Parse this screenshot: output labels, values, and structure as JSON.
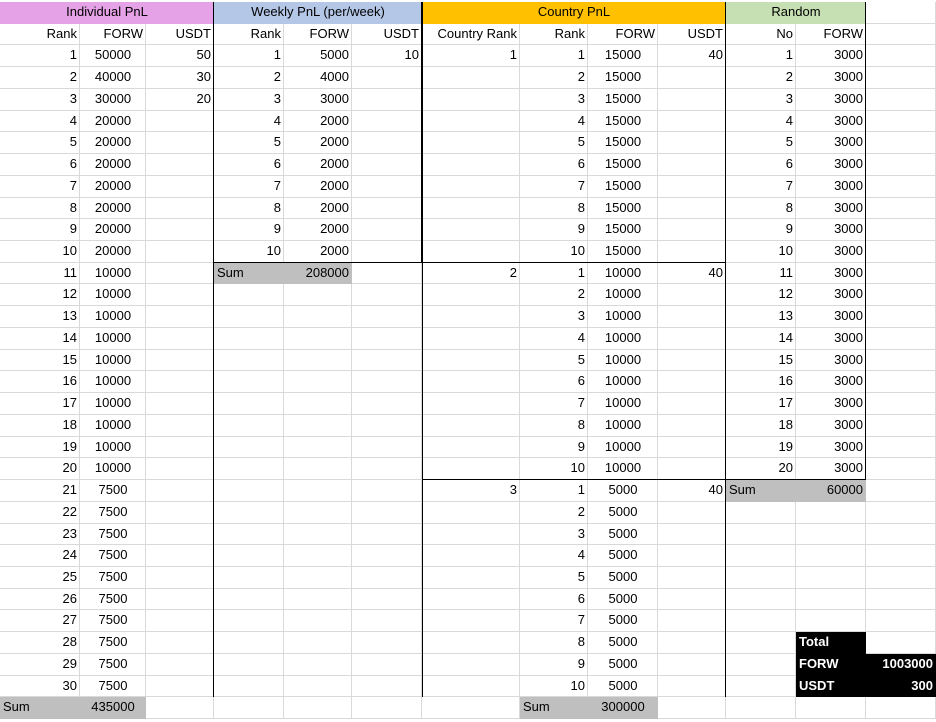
{
  "colors": {
    "individual_header": "#e6a2e6",
    "weekly_header": "#b4c7e7",
    "country_header": "#ffc000",
    "random_header": "#c6e0b4",
    "sum_fill": "#bfbfbf",
    "total_fill": "#000000"
  },
  "sections": {
    "individual": "Individual PnL",
    "weekly": "Weekly PnL (per/week)",
    "country": "Country PnL",
    "random": "Random"
  },
  "headers": {
    "individual": [
      "Rank",
      "FORW",
      "USDT"
    ],
    "weekly": [
      "Rank",
      "FORW",
      "USDT"
    ],
    "country": [
      "Country Rank",
      "Rank",
      "FORW",
      "USDT"
    ],
    "random": [
      "No",
      "FORW"
    ]
  },
  "individual": {
    "ranks": [
      "1",
      "2",
      "3",
      "4",
      "5",
      "6",
      "7",
      "8",
      "9",
      "10",
      "11",
      "12",
      "13",
      "14",
      "15",
      "16",
      "17",
      "18",
      "19",
      "20",
      "21",
      "22",
      "23",
      "24",
      "25",
      "26",
      "27",
      "28",
      "29",
      "30"
    ],
    "forw": [
      "50000",
      "40000",
      "30000",
      "20000",
      "20000",
      "20000",
      "20000",
      "20000",
      "20000",
      "20000",
      "10000",
      "10000",
      "10000",
      "10000",
      "10000",
      "10000",
      "10000",
      "10000",
      "10000",
      "10000",
      "7500",
      "7500",
      "7500",
      "7500",
      "7500",
      "7500",
      "7500",
      "7500",
      "7500",
      "7500"
    ],
    "usdt": [
      "50",
      "30",
      "20"
    ],
    "sum_label": "Sum",
    "sum_value": "435000"
  },
  "weekly": {
    "ranks": [
      "1",
      "2",
      "3",
      "4",
      "5",
      "6",
      "7",
      "8",
      "9",
      "10"
    ],
    "forw": [
      "5000",
      "4000",
      "3000",
      "2000",
      "2000",
      "2000",
      "2000",
      "2000",
      "2000",
      "2000"
    ],
    "usdt": [
      "10"
    ],
    "sum_label": "Sum",
    "sum_value": "208000"
  },
  "country": {
    "groups": [
      {
        "country_rank": "1",
        "usdt": "40",
        "ranks": [
          "1",
          "2",
          "3",
          "4",
          "5",
          "6",
          "7",
          "8",
          "9",
          "10"
        ],
        "forw": [
          "15000",
          "15000",
          "15000",
          "15000",
          "15000",
          "15000",
          "15000",
          "15000",
          "15000",
          "15000"
        ]
      },
      {
        "country_rank": "2",
        "usdt": "40",
        "ranks": [
          "1",
          "2",
          "3",
          "4",
          "5",
          "6",
          "7",
          "8",
          "9",
          "10"
        ],
        "forw": [
          "10000",
          "10000",
          "10000",
          "10000",
          "10000",
          "10000",
          "10000",
          "10000",
          "10000",
          "10000"
        ]
      },
      {
        "country_rank": "3",
        "usdt": "40",
        "ranks": [
          "1",
          "2",
          "3",
          "4",
          "5",
          "6",
          "7",
          "8",
          "9",
          "10"
        ],
        "forw": [
          "5000",
          "5000",
          "5000",
          "5000",
          "5000",
          "5000",
          "5000",
          "5000",
          "5000",
          "5000"
        ]
      }
    ],
    "sum_label": "Sum",
    "sum_value": "300000"
  },
  "random": {
    "nos": [
      "1",
      "2",
      "3",
      "4",
      "5",
      "6",
      "7",
      "8",
      "9",
      "10",
      "11",
      "12",
      "13",
      "14",
      "15",
      "16",
      "17",
      "18",
      "19",
      "20"
    ],
    "forw": [
      "3000",
      "3000",
      "3000",
      "3000",
      "3000",
      "3000",
      "3000",
      "3000",
      "3000",
      "3000",
      "3000",
      "3000",
      "3000",
      "3000",
      "3000",
      "3000",
      "3000",
      "3000",
      "3000",
      "3000"
    ],
    "sum_label": "Sum",
    "sum_value": "60000"
  },
  "totals": {
    "title": "Total",
    "forw_label": "FORW",
    "forw_value": "1003000",
    "usdt_label": "USDT",
    "usdt_value": "300"
  }
}
